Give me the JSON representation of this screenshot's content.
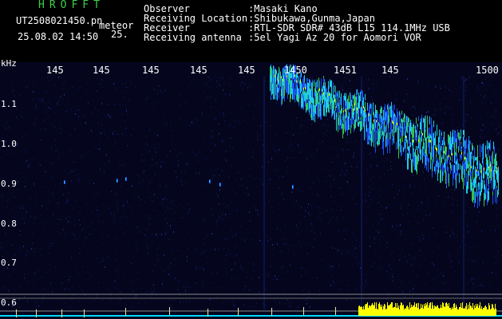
{
  "app": {
    "title": "HROFFT",
    "file_name": "UT2508021450.pn",
    "tag": "meteor",
    "datetime": "25.08.02 14:50",
    "minute_marker": "25."
  },
  "meta": [
    {
      "key": "Observer",
      "value": ":Masaki Kano"
    },
    {
      "key": "Receiving Location",
      "value": ":Shibukawa,Gunma,Japan"
    },
    {
      "key": "Receiver",
      "value": ":RTL-SDR SDR# 43dB L15 114.1MHz USB"
    },
    {
      "key": "Receiving antenna",
      "value": ":5el Yagi Az 20 for Aomori VOR"
    }
  ],
  "axis": {
    "unit": "kHz",
    "freq_labels": [
      "1.1",
      "1.0",
      "0.9",
      "0.8",
      "0.7",
      "0.6"
    ],
    "time_labels": [
      "145",
      "145",
      "145",
      "145",
      "145",
      "1450",
      "1451",
      "145",
      "1500"
    ]
  },
  "colors": {
    "background": "#000000",
    "plot_background": "#05061e",
    "title_green": "#39d046",
    "signal_cyan": "#1ecde6",
    "signal_blue": "#1a4ff0",
    "signal_yellow": "#ffff00",
    "signal_green": "#33c24a",
    "baseline_cyan": "#00d8ff"
  }
}
